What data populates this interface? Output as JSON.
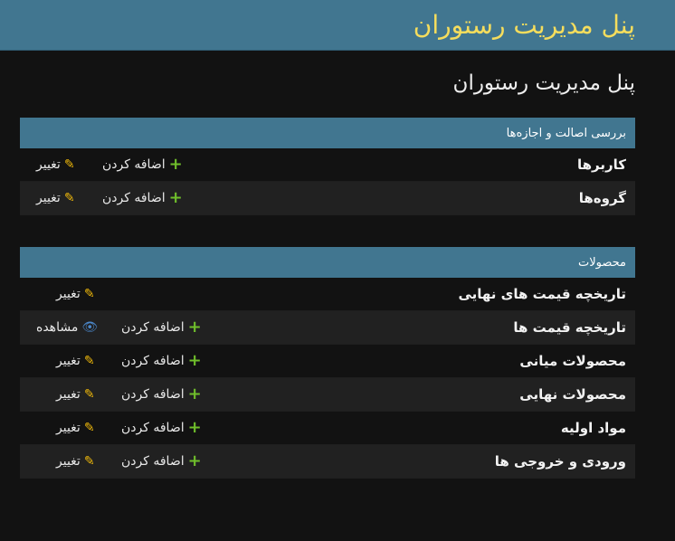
{
  "header": {
    "brand": "پنل مدیریت رستوران"
  },
  "page": {
    "title": "پنل مدیریت رستوران"
  },
  "auth_module": {
    "caption": "بررسی اصالت و اجازه‌ها",
    "rows": [
      {
        "model": "کاربرها",
        "add": "اضافه کردن",
        "change": "تغییر"
      },
      {
        "model": "گروه‌ها",
        "add": "اضافه کردن",
        "change": "تغییر"
      }
    ]
  },
  "products_module": {
    "caption": "محصولات",
    "rows": [
      {
        "model": "تاریخچه قیمت های نهایی",
        "change": "تغییر"
      },
      {
        "model": "تاریخچه قیمت ها",
        "add": "اضافه کردن",
        "view": "مشاهده"
      },
      {
        "model": "محصولات میانی",
        "add": "اضافه کردن",
        "change": "تغییر"
      },
      {
        "model": "محصولات نهایی",
        "add": "اضافه کردن",
        "change": "تغییر"
      },
      {
        "model": "مواد اولیه",
        "add": "اضافه کردن",
        "change": "تغییر"
      },
      {
        "model": "ورودی و خروجی ها",
        "add": "اضافه کردن",
        "change": "تغییر"
      }
    ]
  },
  "icons": {
    "add": "plus-icon",
    "change": "pencil-icon",
    "view": "eye-icon"
  },
  "colors": {
    "header_bg": "#417690",
    "brand": "#f5dd5d",
    "add_icon": "#70bf2b",
    "change_icon": "#efb80b",
    "view_icon": "#4a86c8"
  }
}
